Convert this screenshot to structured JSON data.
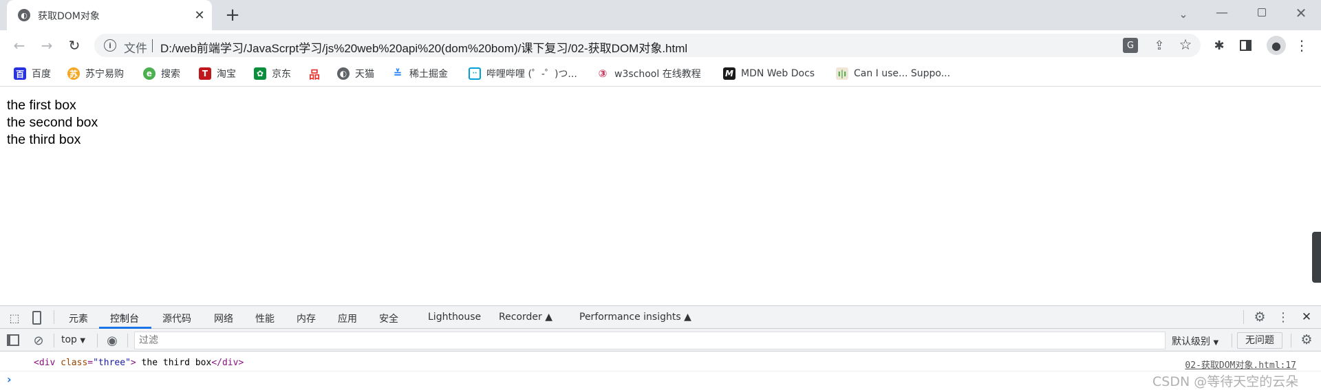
{
  "browser": {
    "tab_title": "获取DOM对象",
    "address": {
      "scheme_label": "文件",
      "url": "D:/web前端学习/JavaScrpt学习/js%20web%20api%20(dom%20bom)/课下复习/02-获取DOM对象.html"
    },
    "bookmarks": [
      {
        "label": "百度",
        "icon": "baidu-icon",
        "color": "#2932e1"
      },
      {
        "label": "苏宁易购",
        "icon": "suning-icon",
        "color": "#f5a623"
      },
      {
        "label": "搜索",
        "icon": "ie-icon",
        "color": "#4caf50"
      },
      {
        "label": "淘宝",
        "icon": "taobao-icon",
        "color": "#c0161c"
      },
      {
        "label": "京东",
        "icon": "jd-icon",
        "color": "#0a8f3c"
      },
      {
        "label": "",
        "icon": "pin-icon",
        "color": "#e53935"
      },
      {
        "label": "天猫",
        "icon": "globe-icon",
        "color": "#5f6368"
      },
      {
        "label": "稀土掘金",
        "icon": "juejin-icon",
        "color": "#1e80ff"
      },
      {
        "label": "哔哩哔哩 (゜-゜)つ...",
        "icon": "bilibili-icon",
        "color": "#00a1d6"
      },
      {
        "label": "w3school 在线教程",
        "icon": "w3school-icon",
        "color": "#c7254e"
      },
      {
        "label": "MDN Web Docs",
        "icon": "mdn-icon",
        "color": "#1b1b1b"
      },
      {
        "label": "Can I use... Suppo...",
        "icon": "caniuse-icon",
        "color": "#4caf50"
      }
    ]
  },
  "page": {
    "lines": [
      "the first box",
      "the second box",
      "the third box"
    ]
  },
  "devtools": {
    "tabs": [
      "元素",
      "控制台",
      "源代码",
      "网络",
      "性能",
      "内存",
      "应用",
      "安全",
      "Lighthouse",
      "Recorder",
      "Performance insights"
    ],
    "active_tab": "控制台",
    "context": "top",
    "filter_placeholder": "过滤",
    "level": "默认级别",
    "issues": "无问题",
    "console": {
      "entry": {
        "open_tag_start": "<div ",
        "attr_name": "class",
        "eq": "=",
        "attr_value": "\"three\"",
        "open_tag_end": ">",
        "text": " the third box",
        "close_tag": "</div>"
      },
      "source": "02-获取DOM对象.html:17",
      "prompt": "›"
    }
  },
  "watermark": "CSDN @等待天空的云朵",
  "colors": {
    "accent": "#1a73e8",
    "tag": "#881280",
    "attr": "#994500",
    "value": "#1a1aa6"
  }
}
